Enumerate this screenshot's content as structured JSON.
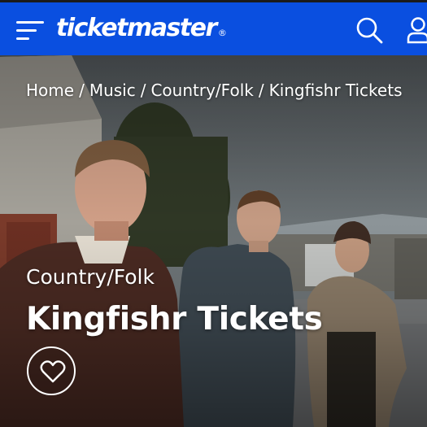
{
  "header": {
    "logo_text": "ticketmaster",
    "logo_mark": "®",
    "brand_color": "#0a4fe0",
    "icons": {
      "menu": "menu-icon",
      "search": "search-icon",
      "account": "user-icon"
    }
  },
  "breadcrumb": {
    "items": [
      "Home",
      "Music",
      "Country/Folk",
      "Kingfishr Tickets"
    ],
    "separator": "/"
  },
  "hero": {
    "genre": "Country/Folk",
    "title": "Kingfishr Tickets",
    "favorite_icon": "heart-icon"
  }
}
